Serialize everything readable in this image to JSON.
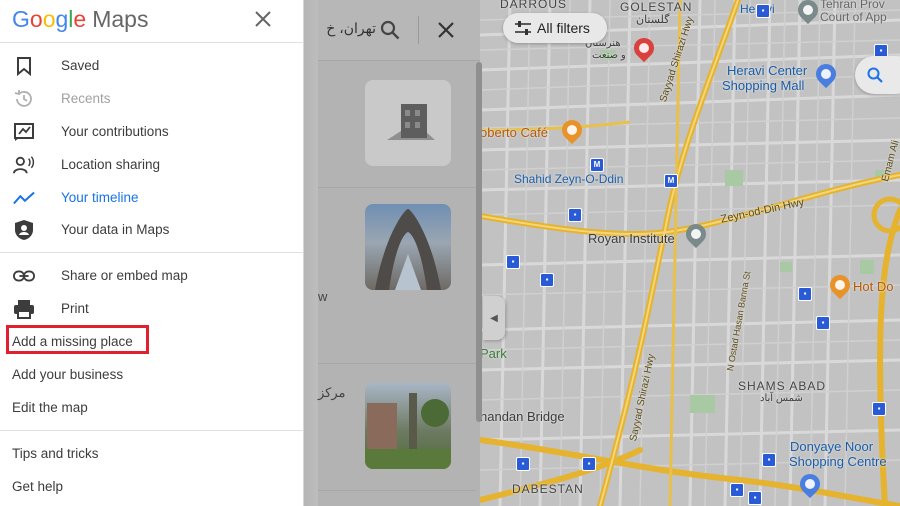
{
  "app": {
    "logo": {
      "G": "G",
      "o1": "o",
      "o2": "o",
      "g": "g",
      "l": "l",
      "e": "e",
      "product": "Maps"
    }
  },
  "menu": {
    "primary": [
      {
        "label": "Saved",
        "icon": "bookmark-icon"
      },
      {
        "label": "Recents",
        "icon": "history-icon"
      },
      {
        "label": "Your contributions",
        "icon": "contributions-icon"
      },
      {
        "label": "Location sharing",
        "icon": "location-sharing-icon"
      },
      {
        "label": "Your timeline",
        "icon": "timeline-icon"
      },
      {
        "label": "Your data in Maps",
        "icon": "shield-icon"
      }
    ],
    "secondary": [
      {
        "label": "Share or embed map",
        "icon": "link-icon"
      },
      {
        "label": "Print",
        "icon": "printer-icon"
      }
    ],
    "tertiary": [
      {
        "label": "Add a missing place"
      },
      {
        "label": "Add your business"
      },
      {
        "label": "Edit the map"
      }
    ],
    "footer": [
      {
        "label": "Tips and tricks"
      },
      {
        "label": "Get help"
      }
    ],
    "highlighted_item": "Add a missing place",
    "highlight_color": "#e0202e",
    "active_color": "#1a73e8"
  },
  "search": {
    "query": "تهران، خ",
    "fragments": [
      "w",
      "مرکز"
    ]
  },
  "filters": {
    "label": "All filters"
  },
  "map": {
    "labels": {
      "darrous": "DARROUS",
      "golestan": "GOLESTAN",
      "golestan_fa": "گلستان",
      "heravi": "Heravi",
      "tehran_prov": "Tehran Prov",
      "court": "Court of App",
      "art_uni_fa_1": "هنرستان",
      "art_uni_fa_2": "و صنعت",
      "heravi_center_1": "Heravi Center",
      "heravi_center_2": "Shopping Mall",
      "roberto": "oberto Café",
      "shahid": "Shahid Zeyn-O-Ddin",
      "royan": "Royan Institute",
      "zeyn_hwy": "Zeyn-od-Din Hwy",
      "hot_do": "Hot Do",
      "park": "Park",
      "shams_abad": "SHAMS ABAD",
      "shams_abad_fa": "شمس آباد",
      "bridge": "handan Bridge",
      "donyaye_1": "Donyaye Noor",
      "donyaye_2": "Shopping Centre",
      "dabestan": "DABESTAN",
      "sayyad_top": "Sayyad Shirazi Hwy",
      "sayyad_bottom": "Sayyad Shirazi Hwy",
      "emam": "Emam Ali",
      "n_ostad": "N Ostad Hasan Banna St"
    }
  }
}
